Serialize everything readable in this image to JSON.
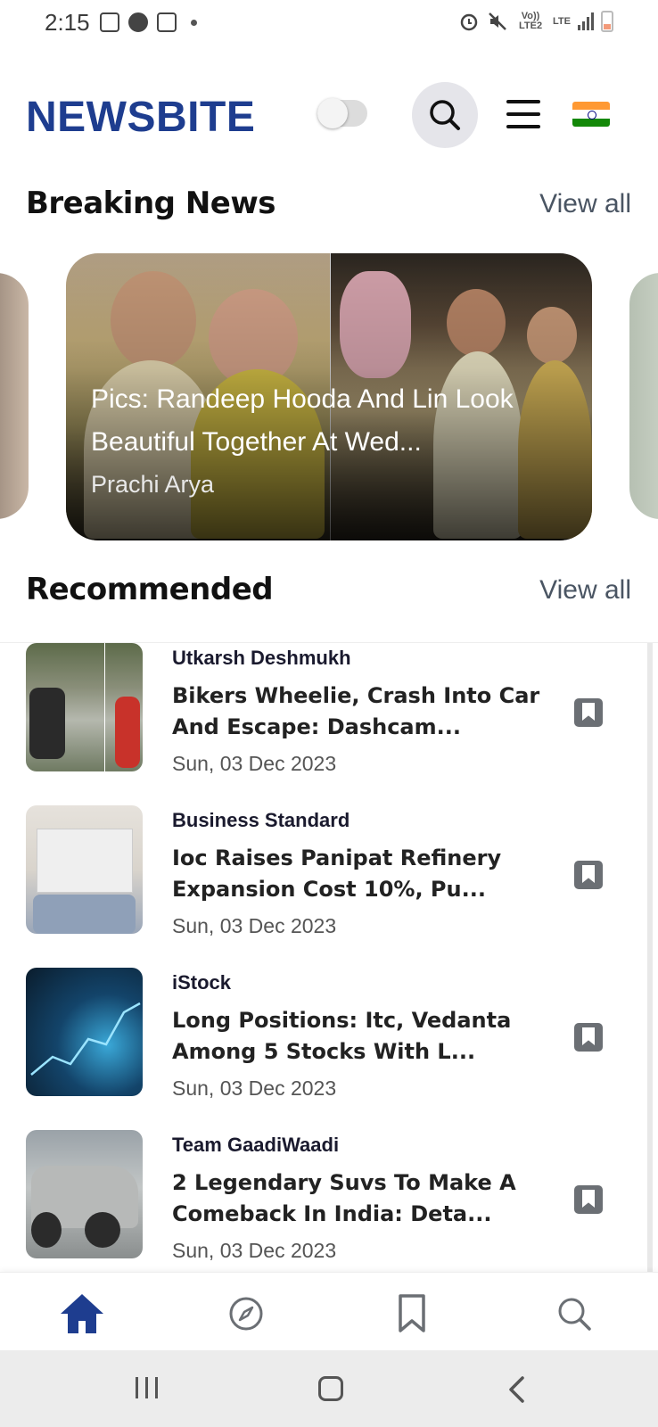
{
  "status_bar": {
    "time": "2:15",
    "left_icons": [
      "gallery-icon",
      "a-circle-icon",
      "calculator-icon",
      "dot-icon"
    ],
    "right_icons": [
      "alarm-icon",
      "mute-icon",
      "volte-icon",
      "lte-icon",
      "signal-icon",
      "battery-icon"
    ],
    "volte_text": "Vo)) LTE2",
    "lte_text": "LTE"
  },
  "header": {
    "brand": "NEWSBITE",
    "theme_toggle": "off",
    "icons": [
      "search-icon",
      "menu-icon",
      "india-flag-icon"
    ]
  },
  "breaking": {
    "title": "Breaking News",
    "view_all": "View all",
    "card": {
      "headline": "Pics: Randeep Hooda And Lin Look Beautiful Together At Wed...",
      "author": "Prachi Arya"
    }
  },
  "recommended": {
    "title": "Recommended",
    "view_all": "View all",
    "items": [
      {
        "source": "Utkarsh Deshmukh",
        "headline": "Bikers Wheelie, Crash Into Car And Escape: Dashcam...",
        "date": "Sun, 03 Dec 2023"
      },
      {
        "source": "Business Standard",
        "headline": "Ioc Raises Panipat Refinery Expansion Cost 10%, Pu...",
        "date": "Sun, 03 Dec 2023"
      },
      {
        "source": "iStock",
        "headline": "Long Positions: Itc, Vedanta Among 5 Stocks With L...",
        "date": "Sun, 03 Dec 2023"
      },
      {
        "source": "Team GaadiWaadi",
        "headline": "2 Legendary Suvs To Make A Comeback In India: Deta...",
        "date": "Sun, 03 Dec 2023"
      }
    ]
  },
  "bottom_nav": {
    "items": [
      "home-icon",
      "explore-icon",
      "bookmark-icon",
      "search-icon"
    ],
    "active": "home-icon",
    "active_color": "#1e3d8f",
    "inactive_color": "#6b6f74"
  },
  "system_nav": [
    "recents-icon",
    "home-icon",
    "back-icon"
  ],
  "colors": {
    "brand": "#1e3d8f",
    "text": "#111111",
    "muted": "#4a5563"
  }
}
